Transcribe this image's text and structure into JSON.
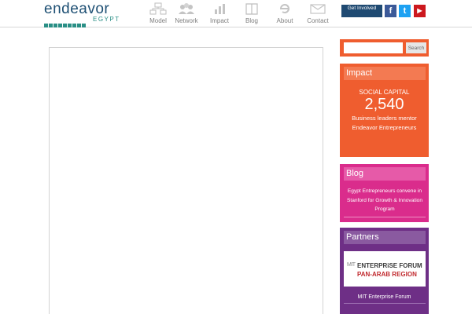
{
  "brand": {
    "logo_word": "endeavor",
    "logo_sub": "EGYPT"
  },
  "nav": {
    "items": [
      {
        "label": "Model",
        "icon": "model-icon"
      },
      {
        "label": "Network",
        "icon": "network-icon"
      },
      {
        "label": "Impact",
        "icon": "impact-icon"
      },
      {
        "label": "Blog",
        "icon": "blog-icon"
      },
      {
        "label": "About",
        "icon": "about-icon"
      },
      {
        "label": "Contact",
        "icon": "contact-icon"
      }
    ]
  },
  "header_actions": {
    "get_involved": "Get Involved",
    "social": [
      {
        "label": "f",
        "name": "facebook-icon",
        "color": "#3b5998"
      },
      {
        "label": "t",
        "name": "twitter-icon",
        "color": "#1da1f2"
      },
      {
        "label": "▶",
        "name": "youtube-icon",
        "color": "#cc181e"
      }
    ]
  },
  "search": {
    "placeholder": "",
    "button": "Search"
  },
  "impact": {
    "title": "Impact",
    "kicker": "SOCIAL CAPITAL",
    "number": "2,540",
    "text": "Business leaders mentor Endeavor Entrepreneurs"
  },
  "blog": {
    "title": "Blog",
    "post": "Egypt Entrepreneurs convene in Stanford for Growth & Innovation Program"
  },
  "partners": {
    "title": "Partners",
    "logo_line1": "ENTERPRiSE FORUM",
    "logo_line2": "PAN-ARAB REGION",
    "logo_mark": "MIT",
    "caption": "MIT Enterprise Forum"
  },
  "colors": {
    "brand_blue": "#1d4f73",
    "orange": "#ef5d2f",
    "magenta": "#da2c8c",
    "purple": "#6e2f86"
  }
}
